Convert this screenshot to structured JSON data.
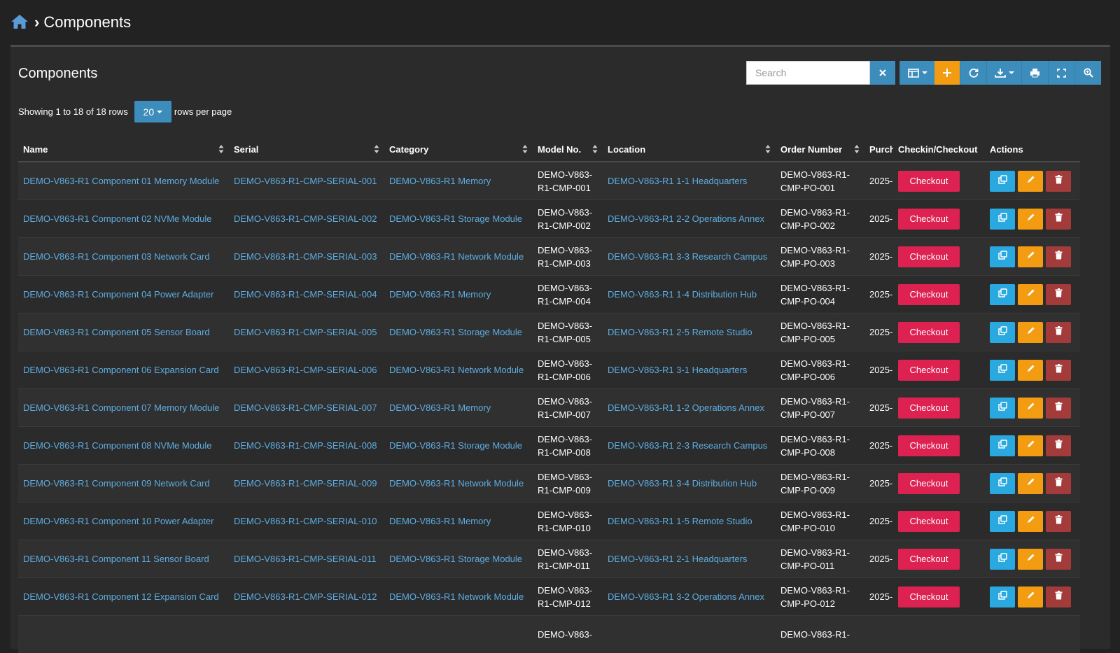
{
  "breadcrumb": {
    "title": "Components"
  },
  "panel": {
    "title": "Components"
  },
  "toolbar": {
    "search_placeholder": "Search"
  },
  "pagination": {
    "prefix": "Showing 1 to 18 of 18 rows",
    "page_size": "20",
    "suffix": "rows per page"
  },
  "columns": [
    "Name",
    "Serial",
    "Category",
    "Model No.",
    "Location",
    "Order Number",
    "Purch",
    "Checkin/Checkout",
    "Actions"
  ],
  "checkout_label": "Checkout",
  "rows": [
    {
      "name": "DEMO-V863-R1 Component 01 Memory Module",
      "serial": "DEMO-V863-R1-CMP-SERIAL-001",
      "category": "DEMO-V863-R1 Memory",
      "model_1": "DEMO-V863-",
      "model_2": "R1-CMP-001",
      "location": "DEMO-V863-R1 1-1 Headquarters",
      "order_1": "DEMO-V863-R1-",
      "order_2": "CMP-PO-001",
      "purchase": "2025-"
    },
    {
      "name": "DEMO-V863-R1 Component 02 NVMe Module",
      "serial": "DEMO-V863-R1-CMP-SERIAL-002",
      "category": "DEMO-V863-R1 Storage Module",
      "model_1": "DEMO-V863-",
      "model_2": "R1-CMP-002",
      "location": "DEMO-V863-R1 2-2 Operations Annex",
      "order_1": "DEMO-V863-R1-",
      "order_2": "CMP-PO-002",
      "purchase": "2025-"
    },
    {
      "name": "DEMO-V863-R1 Component 03 Network Card",
      "serial": "DEMO-V863-R1-CMP-SERIAL-003",
      "category": "DEMO-V863-R1 Network Module",
      "model_1": "DEMO-V863-",
      "model_2": "R1-CMP-003",
      "location": "DEMO-V863-R1 3-3 Research Campus",
      "order_1": "DEMO-V863-R1-",
      "order_2": "CMP-PO-003",
      "purchase": "2025-"
    },
    {
      "name": "DEMO-V863-R1 Component 04 Power Adapter",
      "serial": "DEMO-V863-R1-CMP-SERIAL-004",
      "category": "DEMO-V863-R1 Memory",
      "model_1": "DEMO-V863-",
      "model_2": "R1-CMP-004",
      "location": "DEMO-V863-R1 1-4 Distribution Hub",
      "order_1": "DEMO-V863-R1-",
      "order_2": "CMP-PO-004",
      "purchase": "2025-"
    },
    {
      "name": "DEMO-V863-R1 Component 05 Sensor Board",
      "serial": "DEMO-V863-R1-CMP-SERIAL-005",
      "category": "DEMO-V863-R1 Storage Module",
      "model_1": "DEMO-V863-",
      "model_2": "R1-CMP-005",
      "location": "DEMO-V863-R1 2-5 Remote Studio",
      "order_1": "DEMO-V863-R1-",
      "order_2": "CMP-PO-005",
      "purchase": "2025-"
    },
    {
      "name": "DEMO-V863-R1 Component 06 Expansion Card",
      "serial": "DEMO-V863-R1-CMP-SERIAL-006",
      "category": "DEMO-V863-R1 Network Module",
      "model_1": "DEMO-V863-",
      "model_2": "R1-CMP-006",
      "location": "DEMO-V863-R1 3-1 Headquarters",
      "order_1": "DEMO-V863-R1-",
      "order_2": "CMP-PO-006",
      "purchase": "2025-"
    },
    {
      "name": "DEMO-V863-R1 Component 07 Memory Module",
      "serial": "DEMO-V863-R1-CMP-SERIAL-007",
      "category": "DEMO-V863-R1 Memory",
      "model_1": "DEMO-V863-",
      "model_2": "R1-CMP-007",
      "location": "DEMO-V863-R1 1-2 Operations Annex",
      "order_1": "DEMO-V863-R1-",
      "order_2": "CMP-PO-007",
      "purchase": "2025-"
    },
    {
      "name": "DEMO-V863-R1 Component 08 NVMe Module",
      "serial": "DEMO-V863-R1-CMP-SERIAL-008",
      "category": "DEMO-V863-R1 Storage Module",
      "model_1": "DEMO-V863-",
      "model_2": "R1-CMP-008",
      "location": "DEMO-V863-R1 2-3 Research Campus",
      "order_1": "DEMO-V863-R1-",
      "order_2": "CMP-PO-008",
      "purchase": "2025-"
    },
    {
      "name": "DEMO-V863-R1 Component 09 Network Card",
      "serial": "DEMO-V863-R1-CMP-SERIAL-009",
      "category": "DEMO-V863-R1 Network Module",
      "model_1": "DEMO-V863-",
      "model_2": "R1-CMP-009",
      "location": "DEMO-V863-R1 3-4 Distribution Hub",
      "order_1": "DEMO-V863-R1-",
      "order_2": "CMP-PO-009",
      "purchase": "2025-"
    },
    {
      "name": "DEMO-V863-R1 Component 10 Power Adapter",
      "serial": "DEMO-V863-R1-CMP-SERIAL-010",
      "category": "DEMO-V863-R1 Memory",
      "model_1": "DEMO-V863-",
      "model_2": "R1-CMP-010",
      "location": "DEMO-V863-R1 1-5 Remote Studio",
      "order_1": "DEMO-V863-R1-",
      "order_2": "CMP-PO-010",
      "purchase": "2025-"
    },
    {
      "name": "DEMO-V863-R1 Component 11 Sensor Board",
      "serial": "DEMO-V863-R1-CMP-SERIAL-011",
      "category": "DEMO-V863-R1 Storage Module",
      "model_1": "DEMO-V863-",
      "model_2": "R1-CMP-011",
      "location": "DEMO-V863-R1 2-1 Headquarters",
      "order_1": "DEMO-V863-R1-",
      "order_2": "CMP-PO-011",
      "purchase": "2025-"
    },
    {
      "name": "DEMO-V863-R1 Component 12 Expansion Card",
      "serial": "DEMO-V863-R1-CMP-SERIAL-012",
      "category": "DEMO-V863-R1 Network Module",
      "model_1": "DEMO-V863-",
      "model_2": "R1-CMP-012",
      "location": "DEMO-V863-R1 3-2 Operations Annex",
      "order_1": "DEMO-V863-R1-",
      "order_2": "CMP-PO-012",
      "purchase": "2025-"
    },
    {
      "name": "",
      "serial": "",
      "category": "",
      "model_1": "DEMO-V863-",
      "model_2": "",
      "location": "",
      "order_1": "DEMO-V863-R1-",
      "order_2": "",
      "purchase": ""
    }
  ]
}
